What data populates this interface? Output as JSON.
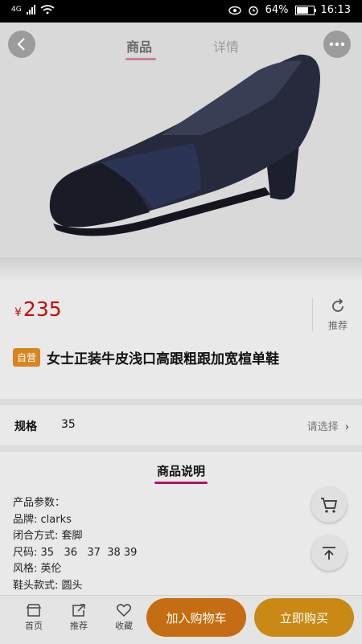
{
  "status_bar": {
    "network": "4G",
    "battery": "64%",
    "battery_level": 0.64,
    "time": "16:13"
  },
  "header": {
    "tabs": [
      {
        "label": "商品",
        "active": true
      },
      {
        "label": "详情",
        "active": false
      }
    ],
    "back_icon": "back-icon",
    "more_icon": "more-icon"
  },
  "product": {
    "currency": "¥",
    "price": "235",
    "badge": "自营",
    "title": "女士正装牛皮浅口高跟粗跟加宽楦单鞋",
    "recommend_label": "推荐"
  },
  "spec": {
    "label": "规格",
    "value": "35",
    "select_label": "请选择"
  },
  "description": {
    "tab_label": "商品说明",
    "params": [
      "产品参数：",
      "品牌: clarks",
      "闭合方式: 套脚",
      "尺码: 35   36   37  38 39",
      "风格: 英伦",
      "鞋头款式: 圆头"
    ]
  },
  "bottom_bar": {
    "home_label": "首页",
    "share_label": "推荐",
    "favorite_label": "收藏",
    "add_to_cart": "加入购物车",
    "buy_now": "立即购买"
  },
  "colors": {
    "price": "#c30d0d",
    "badge": "#d9851f",
    "cart_button": "#c56d12",
    "buy_button": "#c98914",
    "tab_accent": "#b0126f"
  }
}
